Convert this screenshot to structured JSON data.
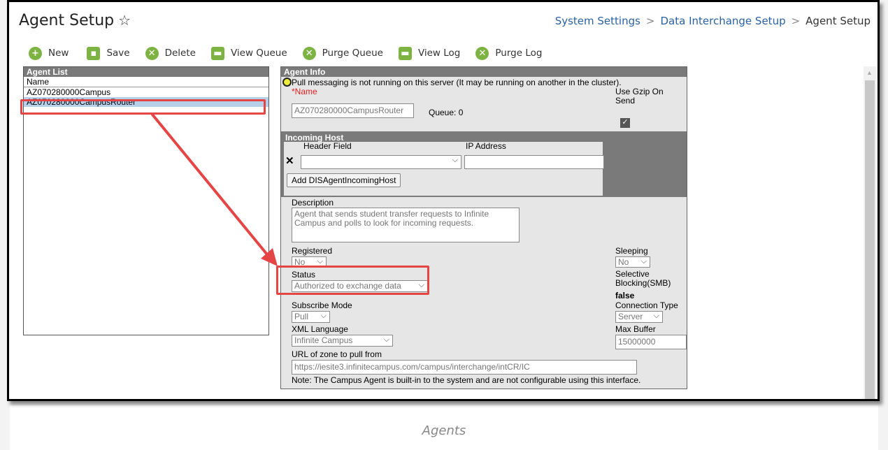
{
  "header": {
    "title": "Agent Setup",
    "star": "☆",
    "breadcrumb": [
      "System Settings",
      "Data Interchange Setup",
      "Agent Setup"
    ]
  },
  "toolbar": [
    {
      "label": "New",
      "icon": "plus-icon",
      "glyph": "+"
    },
    {
      "label": "Save",
      "icon": "floppy-icon",
      "glyph": "▪"
    },
    {
      "label": "Delete",
      "icon": "delete-icon",
      "glyph": "✕"
    },
    {
      "label": "View Queue",
      "icon": "printer-icon",
      "glyph": "▬"
    },
    {
      "label": "Purge Queue",
      "icon": "purge-icon",
      "glyph": "✕"
    },
    {
      "label": "View Log",
      "icon": "printer-icon",
      "glyph": "▬"
    },
    {
      "label": "Purge Log",
      "icon": "purge-icon",
      "glyph": "✕"
    }
  ],
  "agent_list": {
    "header": "Agent List",
    "column": "Name",
    "items": [
      "AZ070280000Campus",
      "AZ070280000CampusRouter"
    ],
    "selected_index": 1
  },
  "agent_info": {
    "header": "Agent Info",
    "status_msg": "Pull messaging is not running on this server (It may be running on another in the cluster).",
    "name_req_mark": "*",
    "name_label": "Name",
    "name_value": "AZ070280000CampusRouter",
    "queue": "Queue: 0",
    "gzip_label": "Use Gzip On Send",
    "gzip_checked": true,
    "incoming_host_header": "Incoming Host",
    "header_field_label": "Header Field",
    "ip_label": "IP Address",
    "header_field_value": "",
    "ip_value": "",
    "add_button": "Add DISAgentIncomingHost",
    "description_label": "Description",
    "description_value": "Agent that sends student transfer requests to Infinite Campus and polls to look for incoming requests.",
    "registered_label": "Registered",
    "registered_value": "No",
    "sleeping_label": "Sleeping",
    "sleeping_value": "No",
    "status_label": "Status",
    "status_value": "Authorized to exchange data",
    "smb_label": "Selective Blocking(SMB)",
    "smb_value": "false",
    "subscribe_label": "Subscribe Mode",
    "subscribe_value": "Pull",
    "connection_label": "Connection Type",
    "connection_value": "Server",
    "xml_label": "XML Language",
    "xml_value": "Infinite Campus",
    "buffer_label": "Max Buffer",
    "buffer_value": "15000000",
    "url_label": "URL of zone to pull from",
    "url_value": "https://iesite3.infinitecampus.com/campus/interchange/intCR/IC",
    "note": "Note: The Campus Agent is built-in to the system and are not configurable using this interface."
  },
  "caption": "Agents",
  "colors": {
    "accent": "#7cb342",
    "link": "#2a62a4",
    "highlight": "#e64545",
    "selected_row": "#b6d0ea",
    "panel_header": "#7a7a7a"
  }
}
